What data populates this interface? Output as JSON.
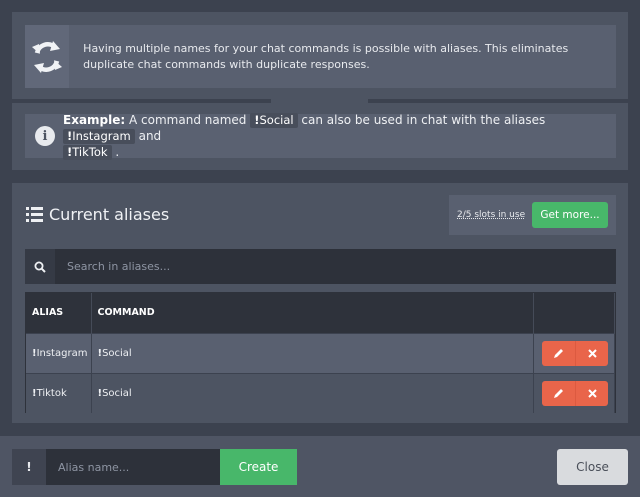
{
  "intro": {
    "icon": "refresh-arrows-icon",
    "text": "Having multiple names for your chat commands is possible with aliases. This eliminates duplicate chat commands with duplicate responses."
  },
  "example": {
    "icon": "info-icon",
    "label": "Example:",
    "text_1": "A command named",
    "cmd_1_bang": "!",
    "cmd_1": "Social",
    "text_2": "can also be used in chat with the aliases",
    "cmd_2_bang": "!",
    "cmd_2": "Instagram",
    "text_3": "and",
    "cmd_3_bang": "!",
    "cmd_3": "TikTok",
    "text_4": "."
  },
  "aliases": {
    "title": "Current aliases",
    "slots": "2/5 slots in use",
    "get_more": "Get more...",
    "search_placeholder": "Search in aliases..."
  },
  "table": {
    "headers": [
      "ALIAS",
      "COMMAND",
      ""
    ],
    "rows": [
      {
        "alias_bang": "!",
        "alias": "Instagram",
        "command_bang": "!",
        "command": "Social"
      },
      {
        "alias_bang": "!",
        "alias": "Tiktok",
        "command_bang": "!",
        "command": "Social"
      }
    ]
  },
  "footer": {
    "prefix": "!",
    "alias_placeholder": "Alias name...",
    "create_label": "Create",
    "close_label": "Close"
  },
  "colors": {
    "accent_green": "#48b76a",
    "danger_orange": "#e9654a",
    "panel": "#4d5462",
    "background": "#3c424f"
  }
}
